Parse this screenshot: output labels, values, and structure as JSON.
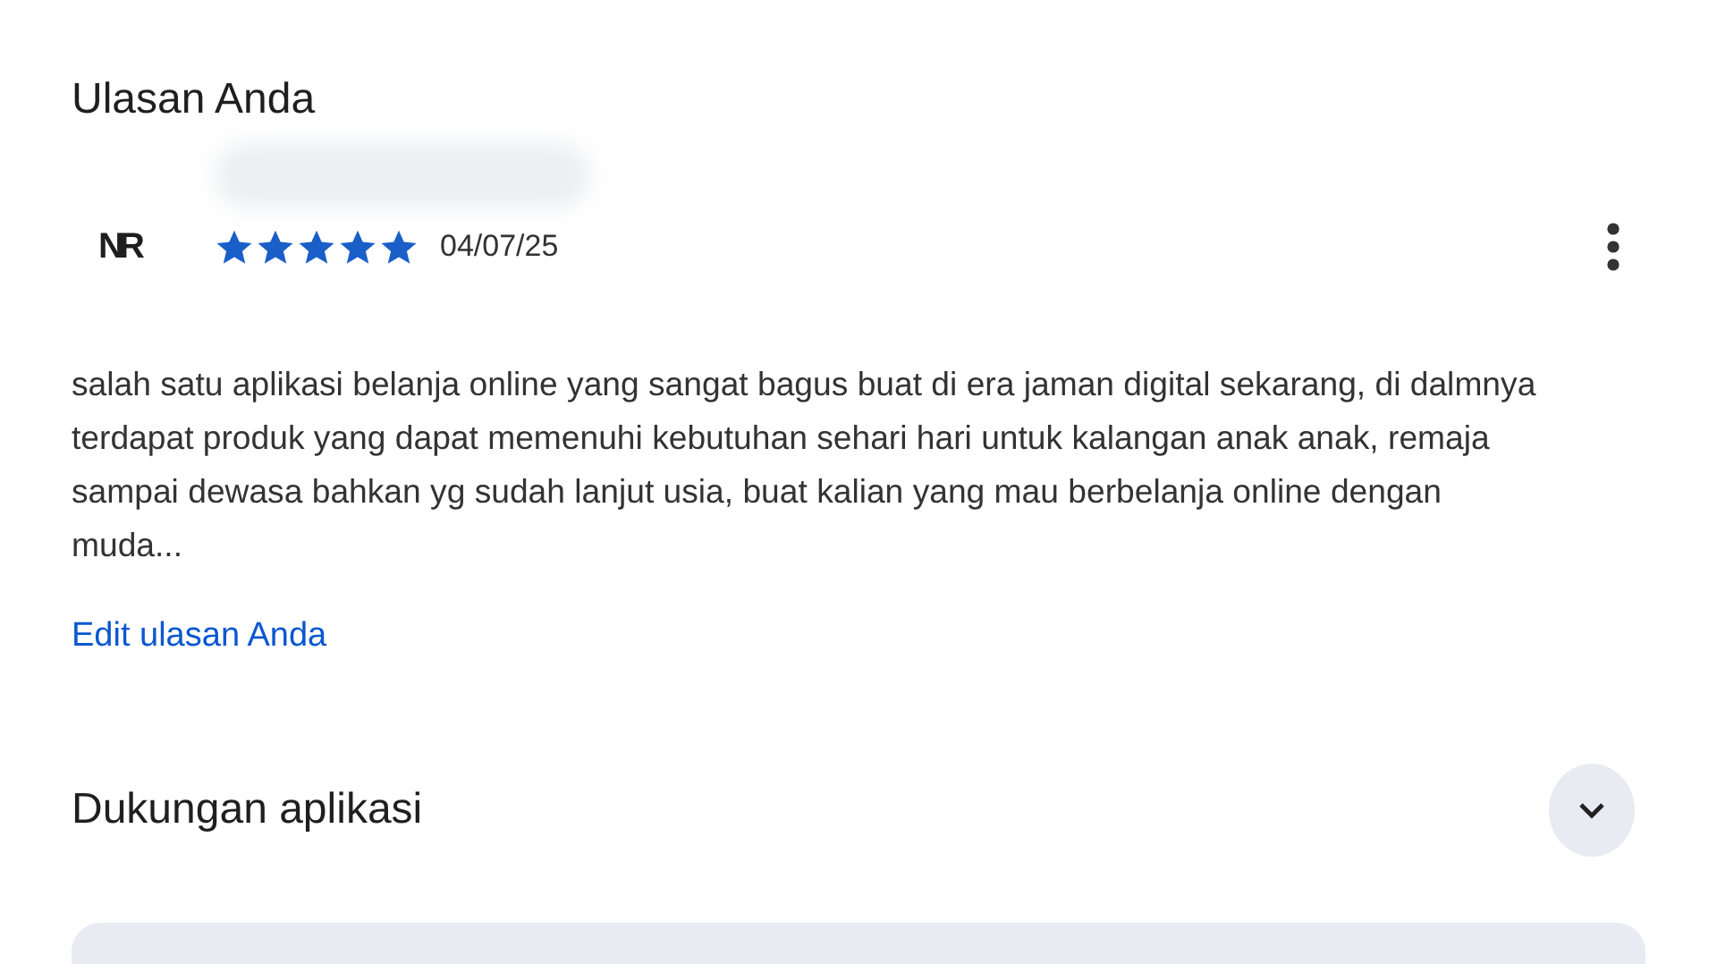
{
  "review_section": {
    "title": "Ulasan Anda",
    "avatar_text": "NR",
    "stars": 5,
    "date": "04/07/25",
    "text": "salah satu aplikasi belanja online yang sangat bagus buat di era jaman digital sekarang, di dalmnya terdapat produk yang dapat memenuhi kebutuhan sehari hari untuk kalangan anak anak, remaja sampai dewasa bahkan yg sudah lanjut usia, buat kalian yang mau berbelanja online dengan muda...",
    "edit_link": "Edit ulasan Anda"
  },
  "support_section": {
    "title": "Dukungan aplikasi",
    "expanded": false
  }
}
